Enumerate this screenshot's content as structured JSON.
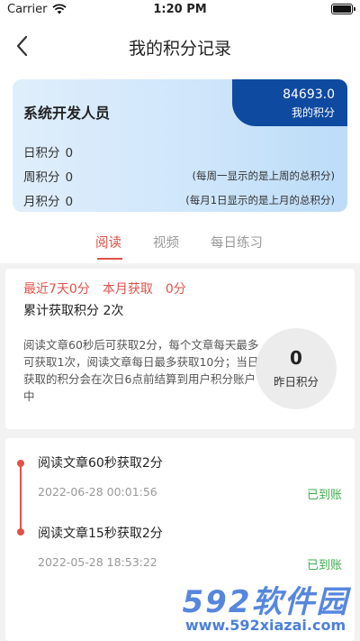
{
  "status_bar": {
    "carrier": "Carrier",
    "time": "1:20 PM"
  },
  "nav": {
    "title": "我的积分记录"
  },
  "card": {
    "name": "系统开发人员",
    "points_value": "84693.0",
    "points_label": "我的积分",
    "daily_label": "日积分",
    "daily_value": "0",
    "weekly_label": "周积分",
    "weekly_value": "0",
    "weekly_note": "(每周一显示的是上周的总积分)",
    "monthly_label": "月积分",
    "monthly_value": "0",
    "monthly_note": "(每月1日显示的是上月的总积分)"
  },
  "tabs": [
    {
      "label": "阅读",
      "active": true
    },
    {
      "label": "视频",
      "active": false
    },
    {
      "label": "每日练习",
      "active": false
    }
  ],
  "summary": {
    "last7_label": "最近7天0分",
    "month_label": "本月获取",
    "month_value": "0分",
    "total": "累计获取积分 2次",
    "description": "阅读文章60秒后可获取2分，每个文章每天最多可获取1次，阅读文章每日最多获取10分；当日获取的积分会在次日6点前结算到用户积分账户中",
    "yesterday_value": "0",
    "yesterday_label": "昨日积分"
  },
  "records": [
    {
      "title": "阅读文章60秒获取2分",
      "date": "2022-06-28 00:01:56",
      "status": "已到账"
    },
    {
      "title": "阅读文章15秒获取2分",
      "date": "2022-05-28 18:53:22",
      "status": "已到账"
    }
  ],
  "watermark": {
    "brand": "592软件园",
    "url": "www.592xiazai.com"
  },
  "colors": {
    "accent": "#e0524a",
    "badge": "#0f4aa1",
    "success": "#3fae50"
  }
}
